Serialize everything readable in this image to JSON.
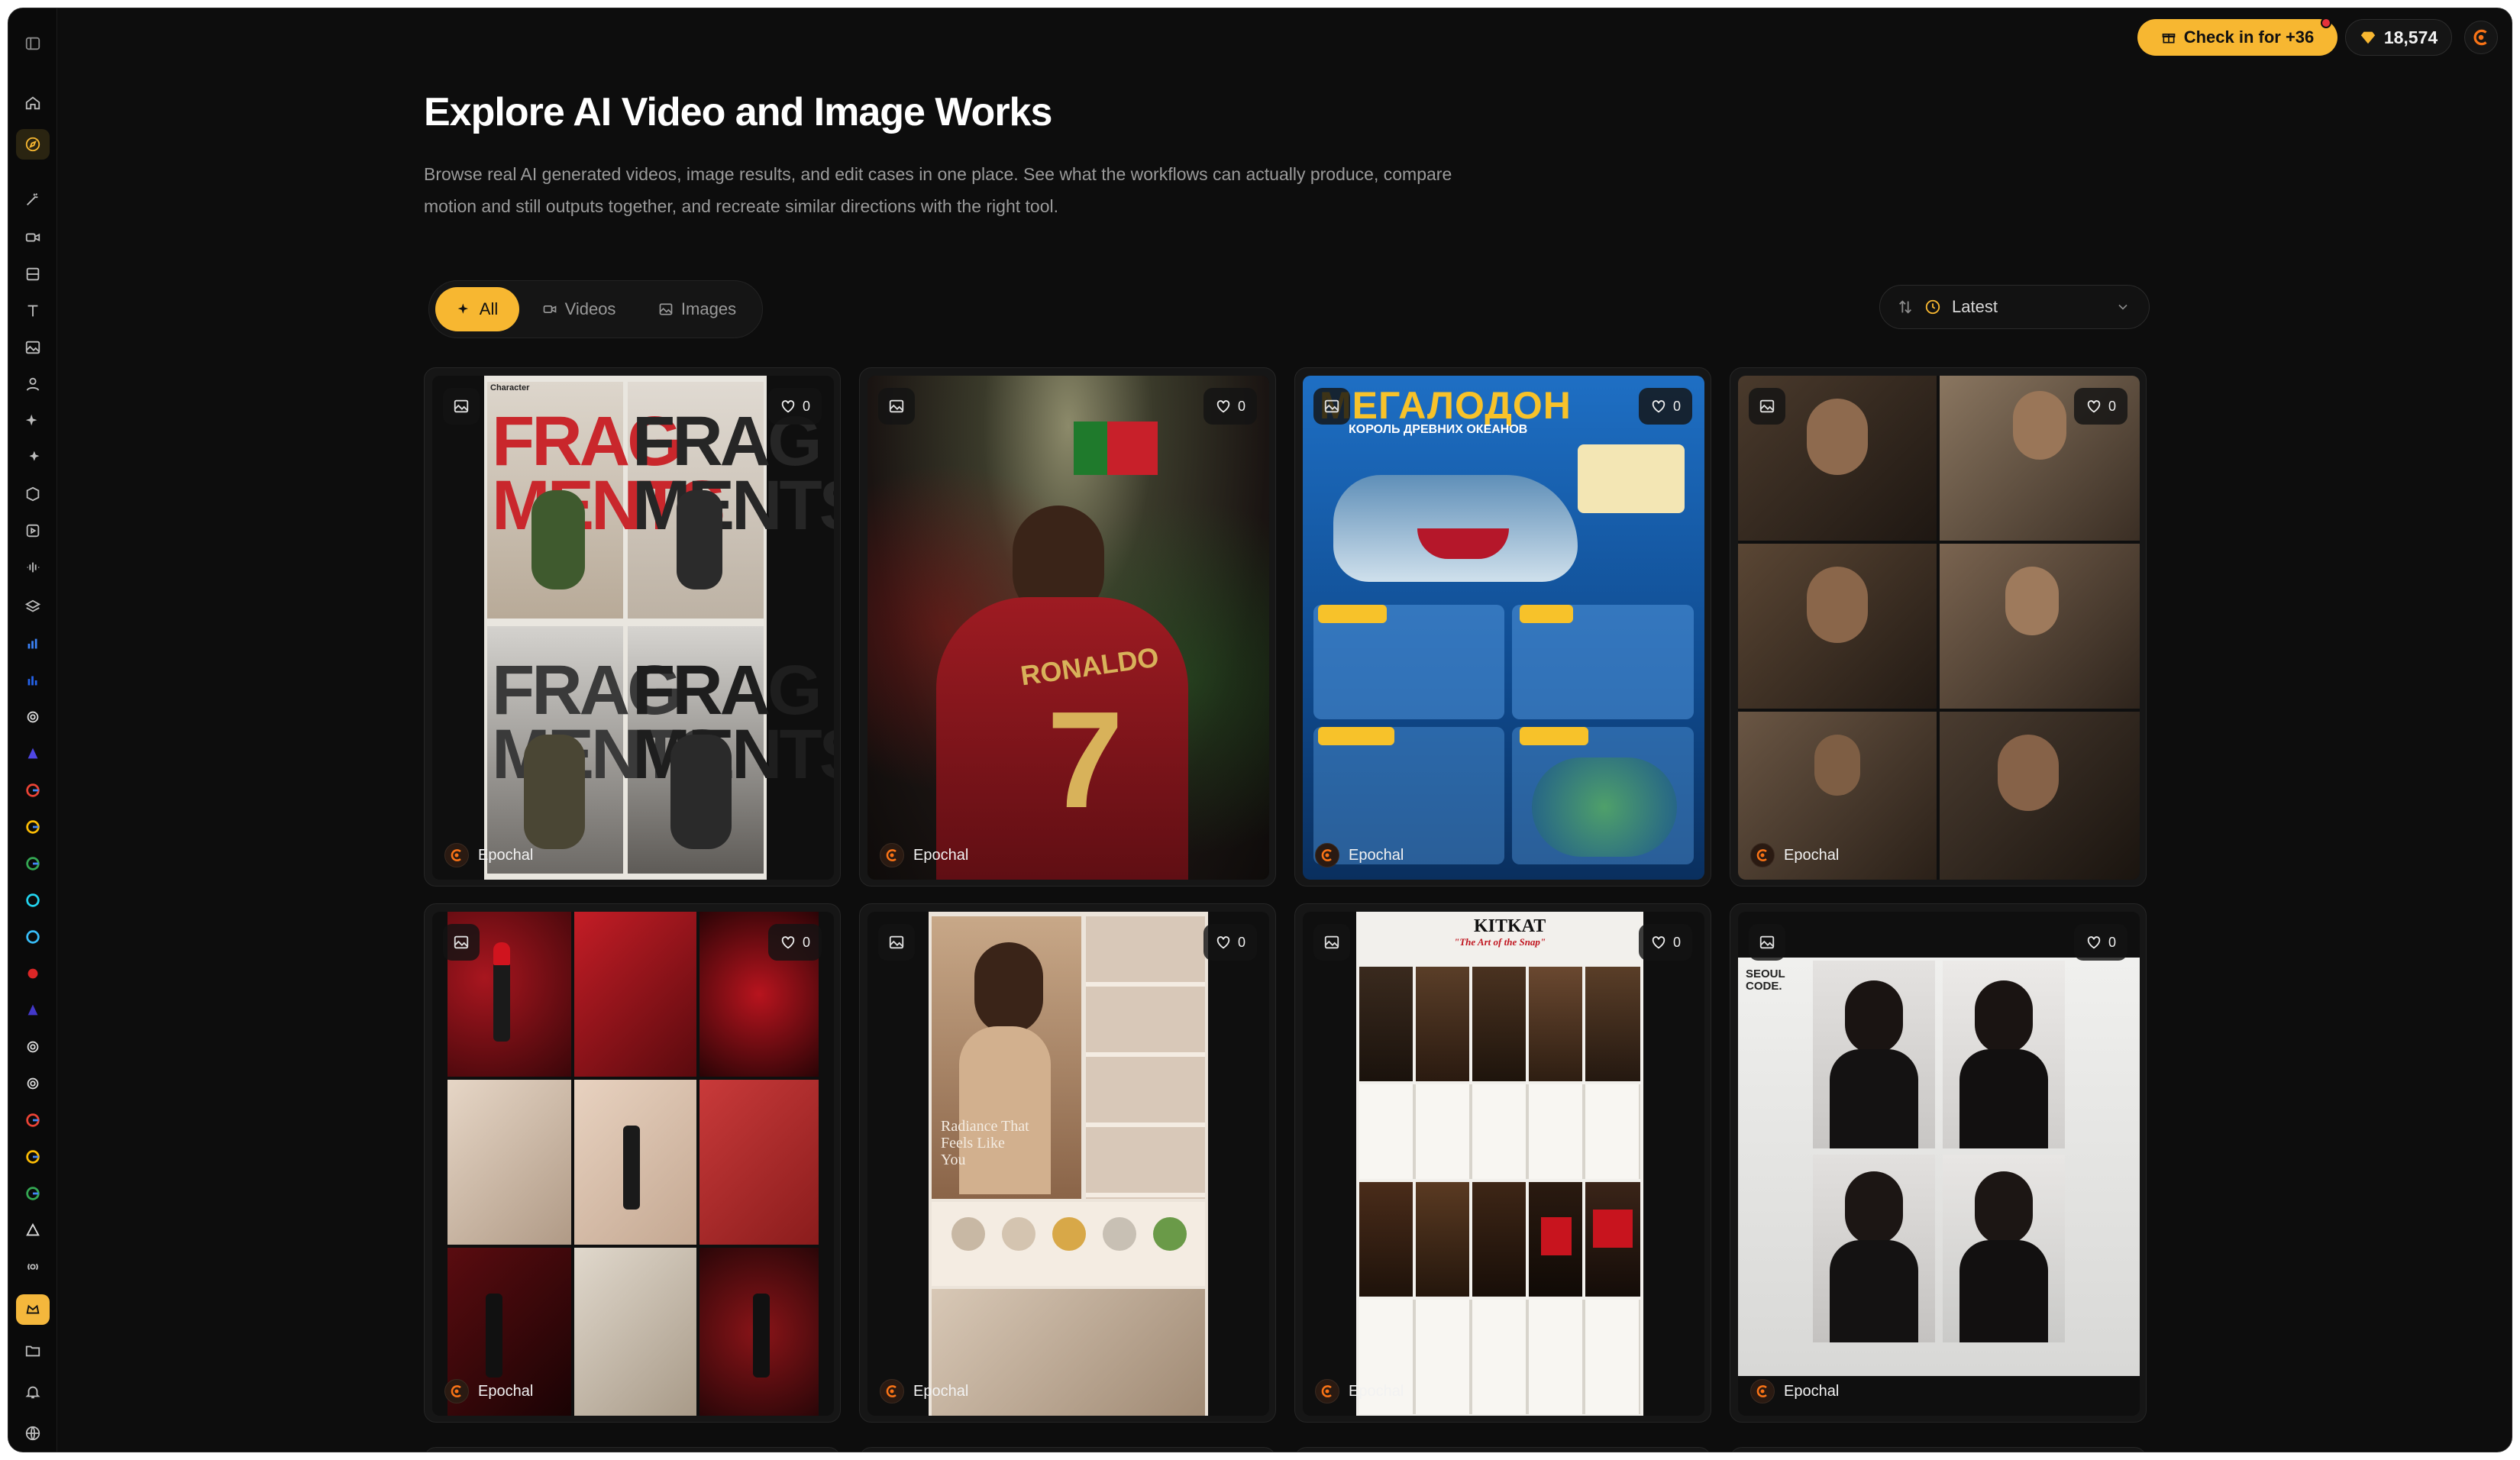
{
  "topbar": {
    "checkin_label": "Check in for +36",
    "credits": "18,574"
  },
  "header": {
    "title": "Explore AI Video and Image Works",
    "description": "Browse real AI generated videos, image results, and edit cases in one place. See what the workflows can actually produce, compare motion and still outputs together, and recreate similar directions with the right tool."
  },
  "filters": {
    "tabs": [
      {
        "label": "All",
        "icon": "sparkle-icon",
        "active": true
      },
      {
        "label": "Videos",
        "icon": "video-icon",
        "active": false
      },
      {
        "label": "Images",
        "icon": "image-icon",
        "active": false
      }
    ],
    "sort_label": "Latest"
  },
  "cards": [
    {
      "type": "image",
      "likes": "0",
      "author": "Epochal",
      "caption": "FRAG MENTS",
      "caption2": "Character"
    },
    {
      "type": "image",
      "likes": "0",
      "author": "Epochal",
      "caption": "RONALDO",
      "caption2": "7"
    },
    {
      "type": "image",
      "likes": "0",
      "author": "Epochal",
      "caption": "МЕГАЛОДОН",
      "caption2": "КОРОЛЬ ДРЕВНИХ ОКЕАНОВ"
    },
    {
      "type": "image",
      "likes": "0",
      "author": "Epochal"
    },
    {
      "type": "image",
      "likes": "0",
      "author": "Epochal"
    },
    {
      "type": "image",
      "likes": "0",
      "author": "Epochal",
      "caption": "Radiance That Feels Like You"
    },
    {
      "type": "image",
      "likes": "0",
      "author": "Epochal",
      "caption": "KITKAT",
      "caption2": "\"The Art of the Snap\""
    },
    {
      "type": "image",
      "likes": "0",
      "author": "Epochal",
      "caption": "SEOUL CODE."
    }
  ],
  "colors": {
    "accent": "#f7b731",
    "background": "#0d0d0d",
    "card": "#161616",
    "notification": "#e5323b"
  },
  "sidebar_icons": [
    "panel-icon",
    "home-icon",
    "compass-icon",
    "magic-wand-icon",
    "video-camera-icon",
    "film-icon",
    "text-icon",
    "image-icon",
    "person-icon",
    "sparkles-icon",
    "sparkles-alt-icon",
    "box-icon",
    "play-box-icon",
    "audio-wave-icon",
    "layers-icon",
    "chart-icon",
    "chart-alt-icon",
    "openai-icon",
    "model-icon",
    "google-icon",
    "google-icon",
    "google-icon",
    "swirl-icon",
    "swirl-icon",
    "model-red-icon",
    "model-blue-icon",
    "openai-icon",
    "openai-icon",
    "google-icon",
    "google-icon",
    "google-icon",
    "triangle-icon",
    "audio-icon",
    "crown-icon",
    "folder-icon",
    "bell-icon",
    "globe-icon"
  ]
}
